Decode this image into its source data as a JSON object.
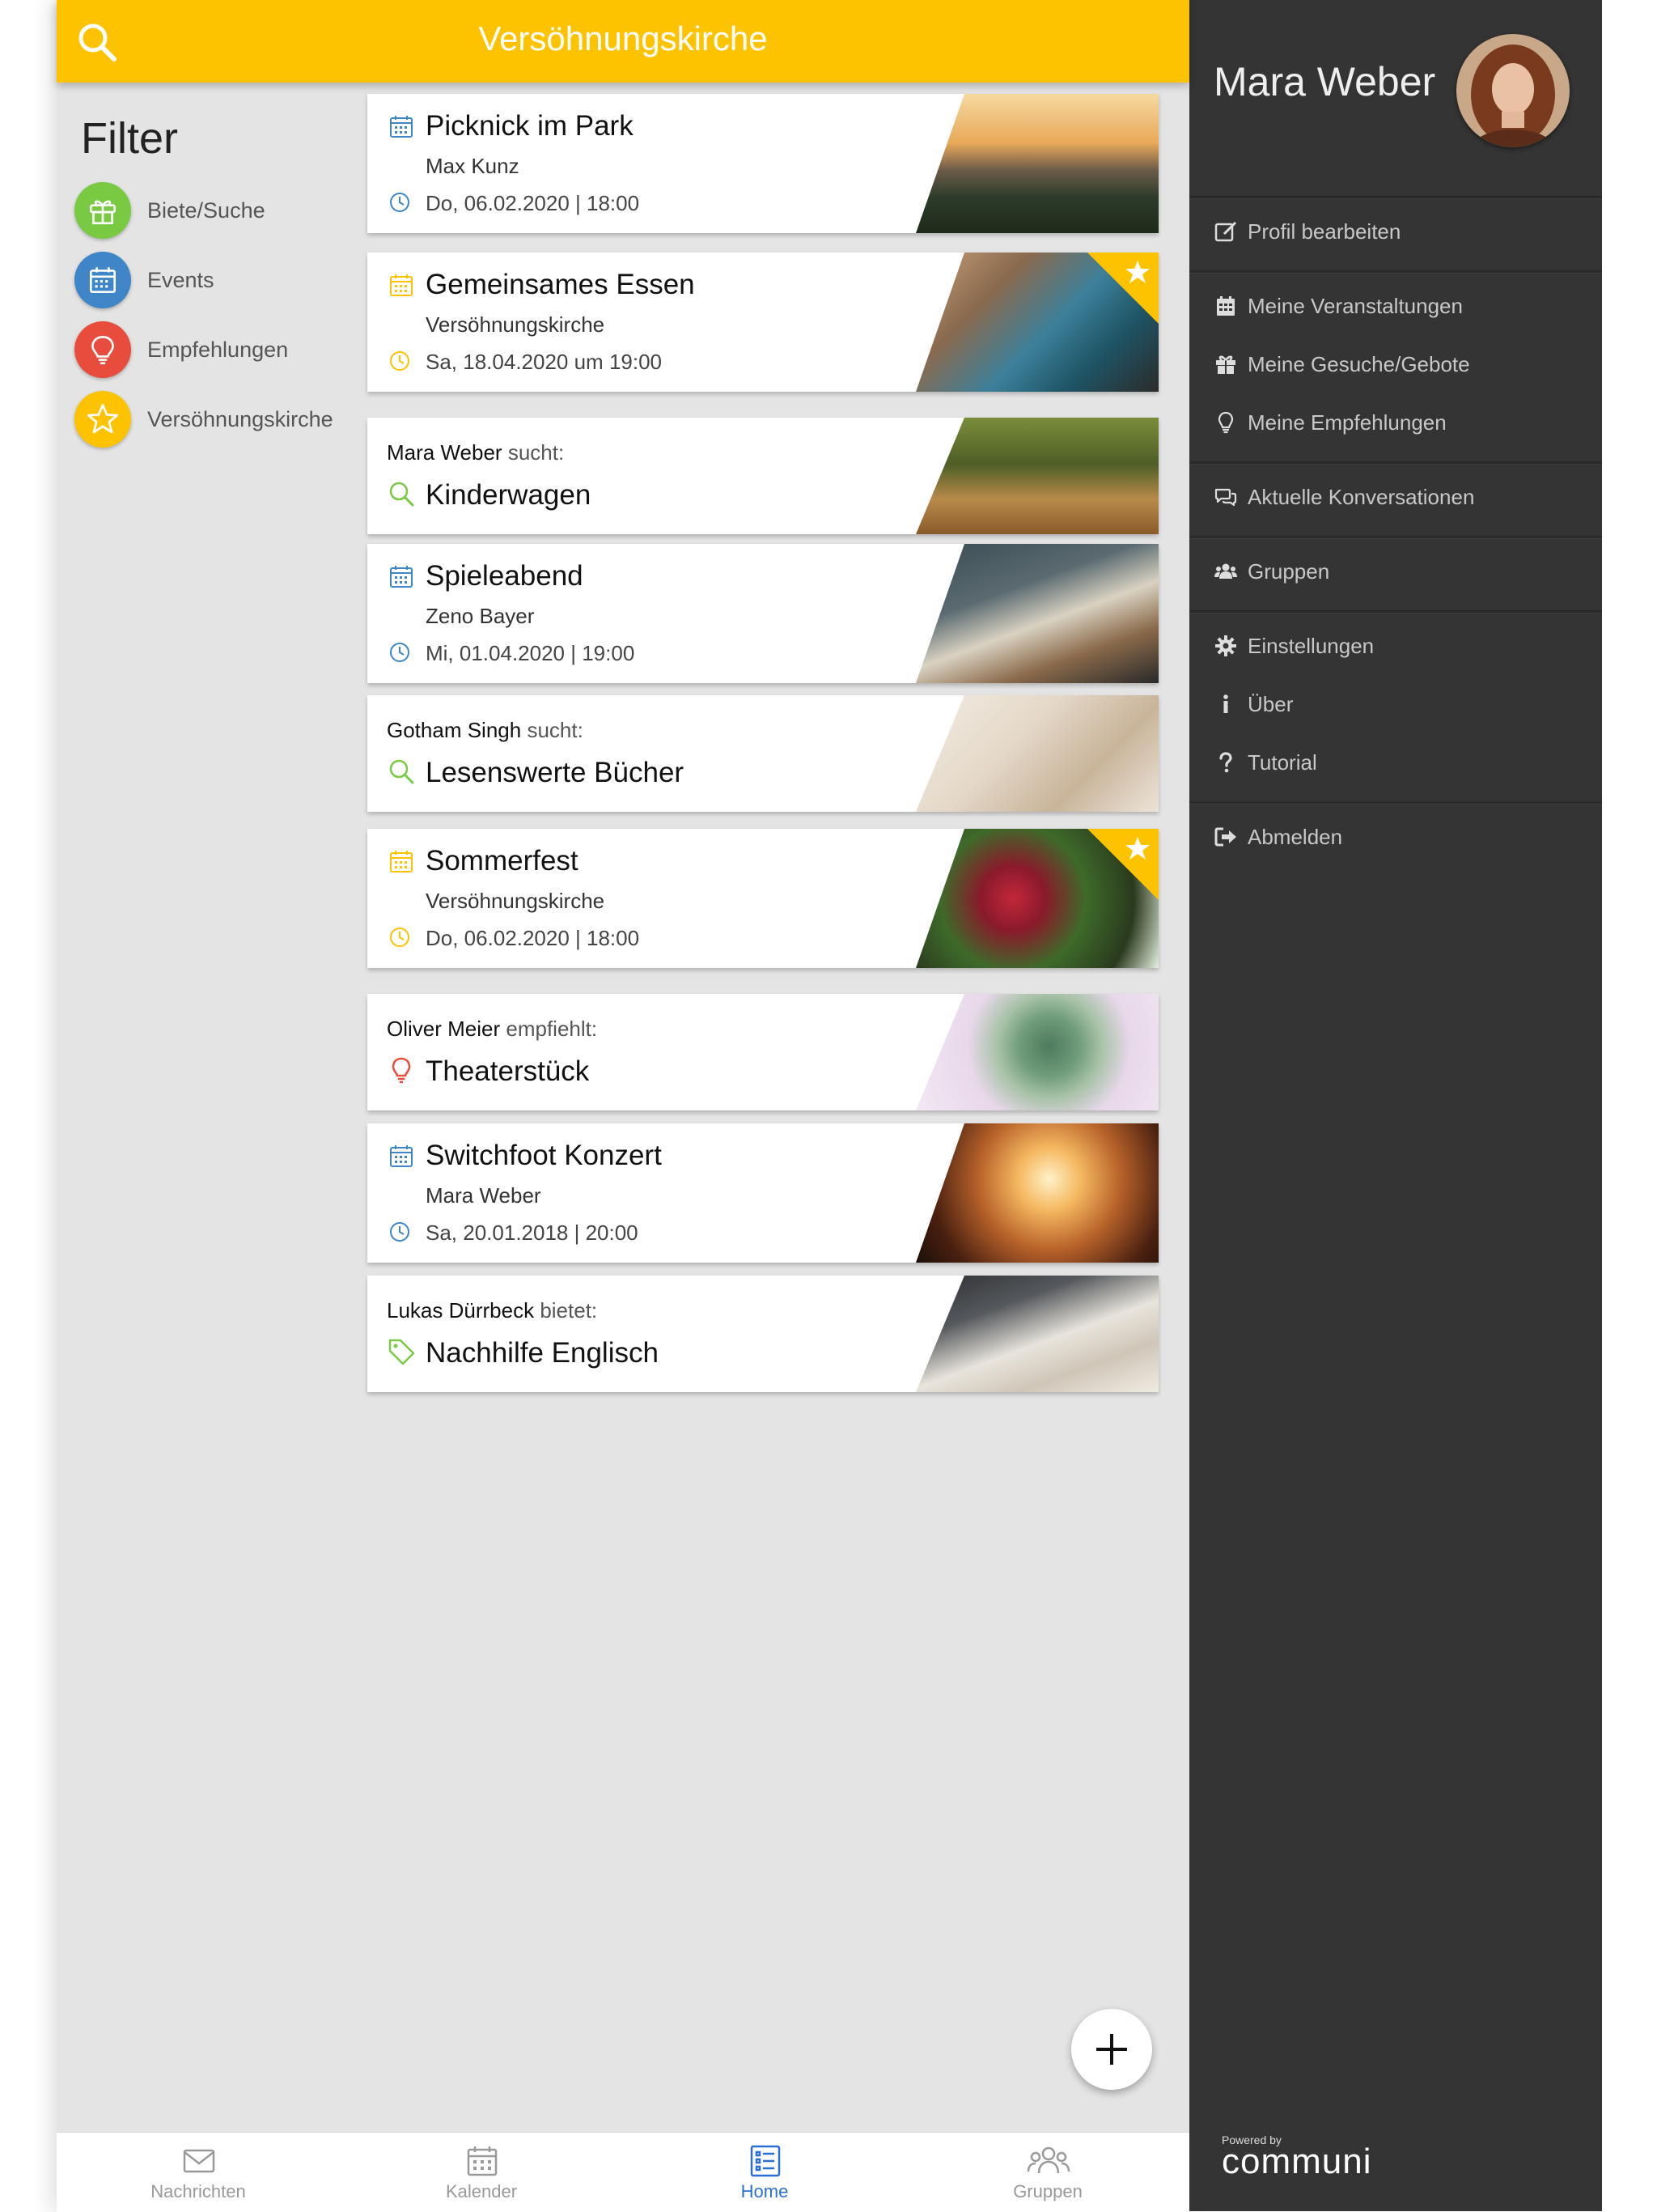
{
  "header": {
    "title": "Versöhnungskirche"
  },
  "filter": {
    "title": "Filter",
    "items": [
      {
        "label": "Biete/Suche",
        "color": "#7ac943",
        "icon": "gift-icon"
      },
      {
        "label": "Events",
        "color": "#3e86c8",
        "icon": "calendar-icon"
      },
      {
        "label": "Empfehlungen",
        "color": "#e74c3c",
        "icon": "lightbulb-icon"
      },
      {
        "label": "Versöhnungskirche",
        "color": "#fdc300",
        "icon": "star-icon"
      }
    ]
  },
  "feed": {
    "cards": [
      {
        "type": "event",
        "title": "Picknick im Park",
        "subtitle": "Max Kunz",
        "date": "Do, 06.02.2020 | 18:00",
        "accent": "#3e86c8",
        "starred": false
      },
      {
        "type": "event",
        "title": "Gemeinsames Essen",
        "subtitle": "Versöhnungskirche",
        "date": "Sa, 18.04.2020 um 19:00",
        "accent": "#fdc300",
        "starred": true
      },
      {
        "type": "post",
        "person": "Mara Weber",
        "verb": "sucht:",
        "title": "Kinderwagen",
        "icon": "search-icon",
        "accent": "#7ac943"
      },
      {
        "type": "event",
        "title": "Spieleabend",
        "subtitle": "Zeno Bayer",
        "date": "Mi, 01.04.2020 | 19:00",
        "accent": "#3e86c8",
        "starred": false
      },
      {
        "type": "post",
        "person": "Gotham Singh",
        "verb": "sucht:",
        "title": "Lesenswerte Bücher",
        "icon": "search-icon",
        "accent": "#7ac943"
      },
      {
        "type": "event",
        "title": "Sommerfest",
        "subtitle": "Versöhnungskirche",
        "date": "Do, 06.02.2020 | 18:00",
        "accent": "#fdc300",
        "starred": true
      },
      {
        "type": "post",
        "person": "Oliver Meier",
        "verb": "empfiehlt:",
        "title": "Theaterstück",
        "icon": "lightbulb-icon",
        "accent": "#e74c3c"
      },
      {
        "type": "event",
        "title": "Switchfoot Konzert",
        "subtitle": "Mara Weber",
        "date": "Sa, 20.01.2018 | 20:00",
        "accent": "#3e86c8",
        "starred": false
      },
      {
        "type": "post",
        "person": "Lukas Dürrbeck",
        "verb": "bietet:",
        "title": "Nachhilfe Englisch",
        "icon": "tag-icon",
        "accent": "#7ac943"
      }
    ]
  },
  "bottom_nav": {
    "items": [
      {
        "label": "Nachrichten",
        "icon": "envelope-icon"
      },
      {
        "label": "Kalender",
        "icon": "calendar-icon"
      },
      {
        "label": "Home",
        "icon": "list-icon",
        "active": true
      },
      {
        "label": "Gruppen",
        "icon": "users-icon"
      }
    ]
  },
  "drawer": {
    "user_name": "Mara Weber",
    "menu": [
      {
        "label": "Profil bearbeiten",
        "icon": "edit-icon"
      },
      {
        "label": "Meine Veranstaltungen",
        "icon": "calendar-icon"
      },
      {
        "label": "Meine Gesuche/Gebote",
        "icon": "gift-icon"
      },
      {
        "label": "Meine Empfehlungen",
        "icon": "lightbulb-icon"
      },
      {
        "label": "Aktuelle Konversationen",
        "icon": "comments-icon"
      },
      {
        "label": "Gruppen",
        "icon": "users-icon"
      },
      {
        "label": "Einstellungen",
        "icon": "gear-icon"
      },
      {
        "label": "Über",
        "icon": "info-icon"
      },
      {
        "label": "Tutorial",
        "icon": "question-icon"
      },
      {
        "label": "Abmelden",
        "icon": "sign-out-icon"
      }
    ],
    "powered_by": "Powered by",
    "brand": "communi"
  }
}
